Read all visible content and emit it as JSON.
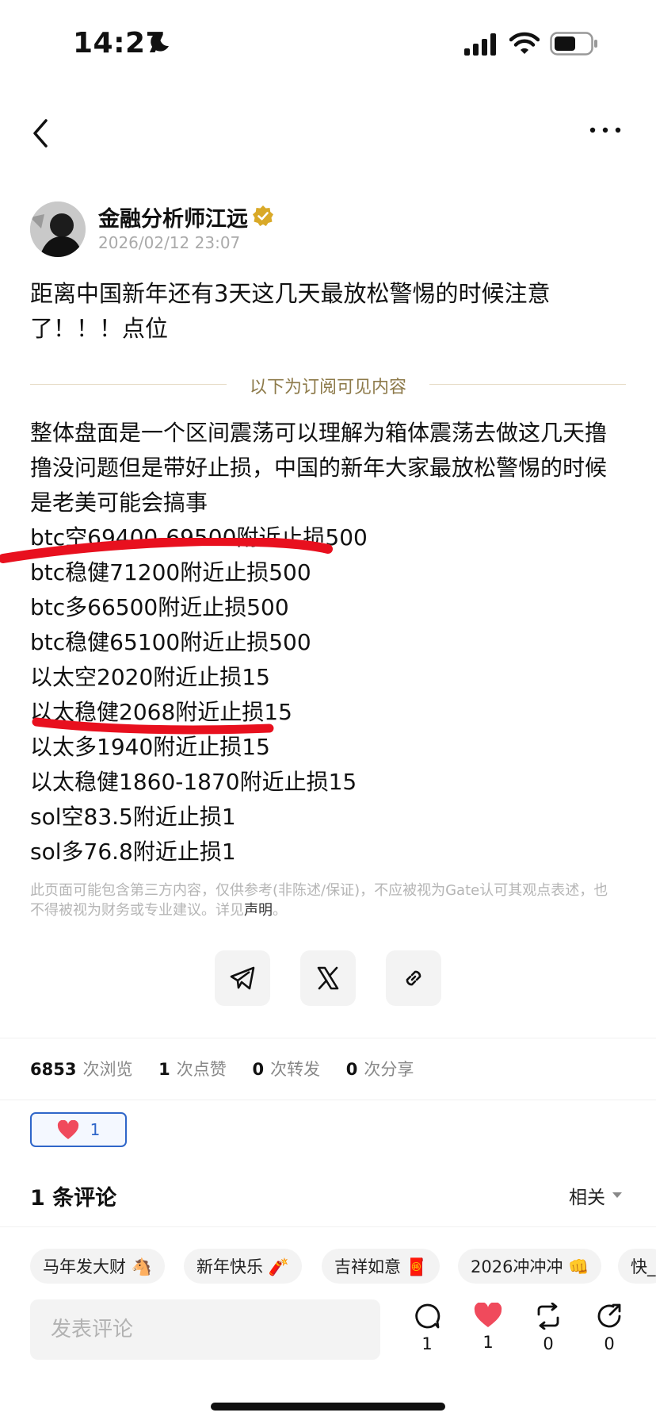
{
  "status_bar": {
    "time": "14:27"
  },
  "author": {
    "name": "金融分析师江远",
    "date": "2026/02/12 23:07"
  },
  "post": {
    "title": "距离中国新年还有3天这几天最放松警惕的时候注意了！！！点位",
    "subscriber_label": "以下为订阅可见内容",
    "intro": [
      "整体盘面是一个区间震荡可以理解为箱体震荡去做这几天撸",
      "撸没问题但是带好止损，中国的新年大家最放松警惕的时候",
      "是老美可能会搞事"
    ],
    "levels": [
      "btc空69400-69500附近止损500",
      "btc稳健71200附近止损500",
      "btc多66500附近止损500",
      "btc稳健65100附近止损500",
      "以太空2020附近止损15",
      "以太稳健2068附近止损15",
      "以太多1940附近止损15",
      "以太稳健1860-1870附近止损15",
      "sol空83.5附近止损1",
      "sol多76.8附近止损1"
    ],
    "disclaimer_prefix": "此页面可能包含第三方内容，仅供参考(非陈述/保证)，不应被视为Gate认可其观点表述，也不得被视为财务或专业建议。详见",
    "disclaimer_link": "声明",
    "disclaimer_suffix": "。"
  },
  "stats": {
    "views": "6853",
    "views_label": "次浏览",
    "likes": "1",
    "likes_label": "次点赞",
    "reposts": "0",
    "reposts_label": "次转发",
    "shares": "0",
    "shares_label": "次分享"
  },
  "like_chip_count": "1",
  "comments": {
    "title": "1 条评论",
    "sort": "相关"
  },
  "quick_replies": [
    "马年发大财 🐴",
    "新年快乐 🧨",
    "吉祥如意 🧧",
    "2026冲冲冲 👊",
    "快_"
  ],
  "comment_input": {
    "placeholder": "发表评论"
  },
  "actions": {
    "comment": "1",
    "like": "1",
    "repost": "0",
    "share": "0"
  },
  "colors": {
    "accent_blue": "#2f66c9",
    "heart_red": "#f04a5c",
    "annotation_red": "#e8101e",
    "gold": "#d9a928"
  }
}
